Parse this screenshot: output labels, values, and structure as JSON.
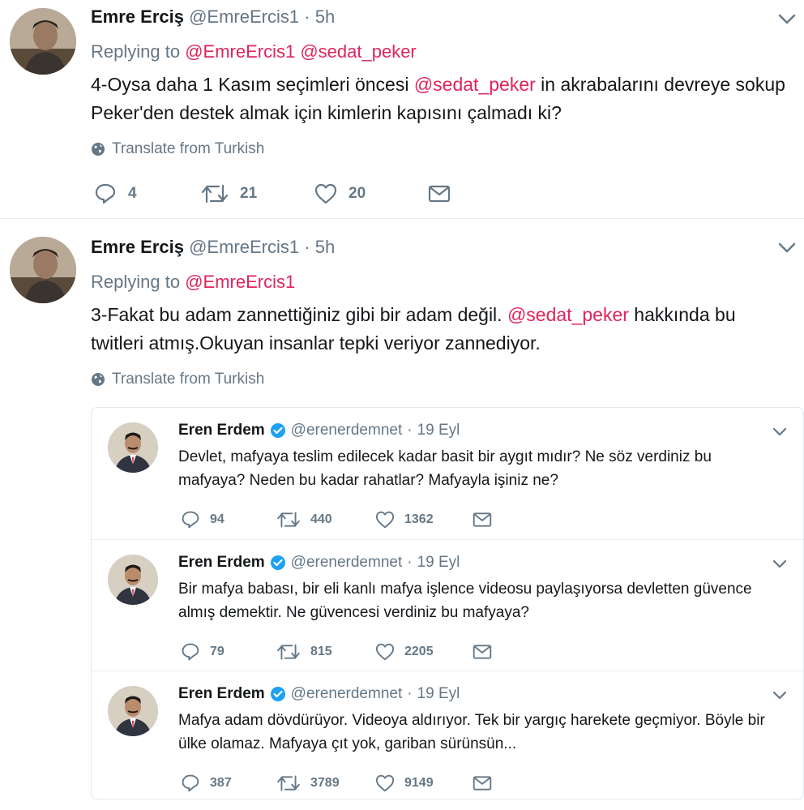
{
  "tweets": [
    {
      "name": "Emre Erciş",
      "handle": "@EmreErcis1",
      "dot": "·",
      "time": "5h",
      "replying_prefix": "Replying to ",
      "replying_to": [
        "@EmreErcis1",
        "@sedat_peker"
      ],
      "text_1": "4-Oysa daha 1 Kasım seçimleri öncesi ",
      "text_mention": "@sedat_peker",
      "text_2": " in akrabalarını devreye sokup Peker'den destek almak için kimlerin kapısını çalmadı ki?",
      "translate": "Translate from Turkish",
      "replies": "4",
      "retweets": "21",
      "likes": "20"
    },
    {
      "name": "Emre Erciş",
      "handle": "@EmreErcis1",
      "dot": "·",
      "time": "5h",
      "replying_prefix": "Replying to ",
      "replying_to": [
        "@EmreErcis1"
      ],
      "text_1": "3-Fakat bu adam zannettiğiniz gibi bir adam değil. ",
      "text_mention": "@sedat_peker",
      "text_2": " hakkında bu twitleri atmış.Okuyan insanlar tepki veriyor zannediyor.",
      "translate": "Translate from Turkish"
    }
  ],
  "quotes": [
    {
      "name": "Eren Erdem",
      "handle": "@erenerdemnet",
      "dot": "·",
      "time": "19 Eyl",
      "text": "Devlet, mafyaya teslim edilecek kadar basit bir aygıt mıdır? Ne söz verdiniz bu mafyaya? Neden bu kadar rahatlar? Mafyayla işiniz ne?",
      "replies": "94",
      "retweets": "440",
      "likes": "1362"
    },
    {
      "name": "Eren Erdem",
      "handle": "@erenerdemnet",
      "dot": "·",
      "time": "19 Eyl",
      "text": "Bir mafya babası, bir eli kanlı mafya işlence videosu paylaşıyorsa devletten güvence almış demektir. Ne güvencesi verdiniz bu mafyaya?",
      "replies": "79",
      "retweets": "815",
      "likes": "2205"
    },
    {
      "name": "Eren Erdem",
      "handle": "@erenerdemnet",
      "dot": "·",
      "time": "19 Eyl",
      "text": "Mafya adam dövdürüyor. Videoya aldırıyor. Tek bir yargıç harekete geçmiyor. Böyle bir ülke olamaz. Mafyaya çıt yok, gariban sürünsün...",
      "replies": "387",
      "retweets": "3789",
      "likes": "9149"
    }
  ],
  "colors": {
    "mention": "#e0245e",
    "muted": "#657786",
    "text": "#14171a",
    "verified": "#1da1f2",
    "border": "#e6ecf0"
  },
  "icons": [
    "avatar",
    "chevron-down-icon",
    "globe-icon",
    "reply-icon",
    "retweet-icon",
    "like-icon",
    "message-icon",
    "verified-badge-icon"
  ]
}
